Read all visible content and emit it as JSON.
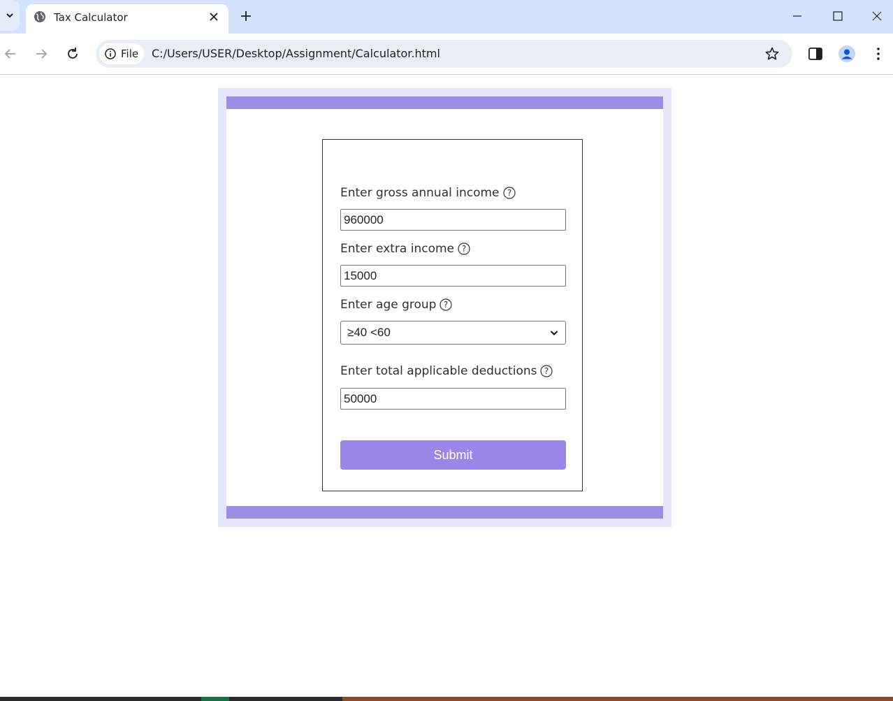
{
  "browser": {
    "tab_title": "Tax Calculator",
    "site_chip_label": "File",
    "url": "C:/Users/USER/Desktop/Assignment/Calculator.html",
    "icons": {
      "tab_search": "chevron-down-icon",
      "favicon": "globe-icon",
      "tab_close": "close-icon",
      "new_tab": "plus-icon",
      "minimize": "minimize-icon",
      "maximize": "maximize-icon",
      "close_window": "close-icon",
      "back": "arrow-left-icon",
      "forward": "arrow-right-icon",
      "reload": "reload-icon",
      "site_info": "info-icon",
      "bookmark": "star-icon",
      "side_panel": "side-panel-icon",
      "profile": "profile-icon",
      "menu": "more-vert-icon"
    }
  },
  "form": {
    "gross_income": {
      "label": "Enter gross annual income",
      "value": "960000"
    },
    "extra_income": {
      "label": "Enter extra income",
      "value": "15000"
    },
    "age_group": {
      "label": "Enter age group",
      "selected": "≥40 <60"
    },
    "deductions": {
      "label": "Enter total applicable deductions",
      "value": "50000"
    },
    "submit_label": "Submit"
  },
  "colors": {
    "accent_band": "#9b8fe3",
    "frame_bg": "#e6e6fa",
    "submit_bg": "#9b85e6",
    "tabstrip_bg": "#d3e3fd"
  }
}
